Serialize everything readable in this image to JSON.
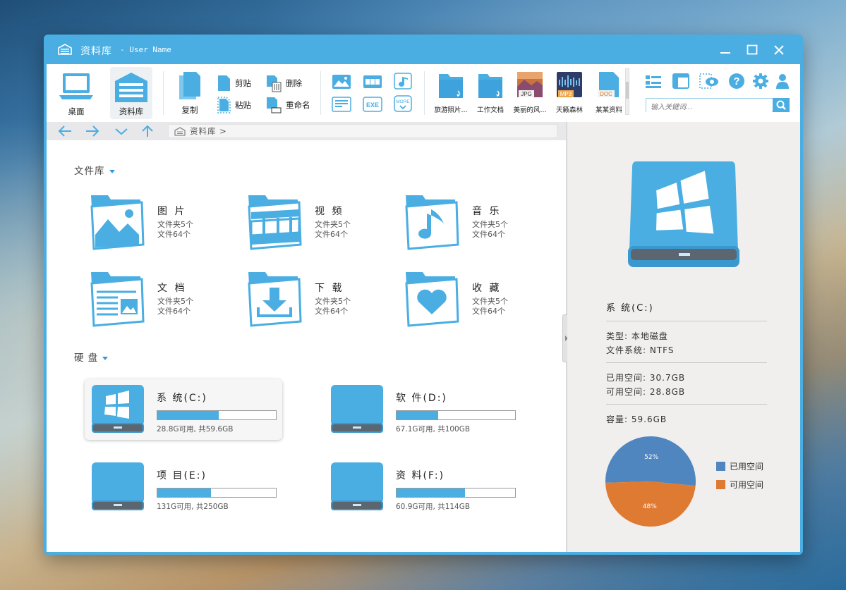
{
  "window": {
    "title": "资料库",
    "subtitle": "- User Name",
    "accent": "#4aaee2"
  },
  "toolbar": {
    "desktop_label": "桌面",
    "library_label": "资料库",
    "copy_label": "复制",
    "cut_label": "剪贴",
    "paste_label": "粘贴",
    "delete_label": "删除",
    "rename_label": "重命名",
    "recent": [
      {
        "label": "旅游照片...",
        "icon": "folder-icon"
      },
      {
        "label": "工作文档",
        "icon": "folder-icon"
      },
      {
        "label": "美丽的风...",
        "badge": "JPG",
        "icon": "jpg-file-icon"
      },
      {
        "label": "天籁森林",
        "badge": "MP3",
        "icon": "mp3-file-icon"
      },
      {
        "label": "某某资料",
        "badge": "DOC",
        "icon": "doc-file-icon"
      }
    ],
    "search_placeholder": "输入关键词..."
  },
  "nav": {
    "breadcrumb": "资料库 >"
  },
  "libraries": {
    "title": "文件库",
    "items": [
      {
        "name": "图 片",
        "folders": "文件夹5个",
        "files": "文件64个",
        "icon": "pictures-folder-icon"
      },
      {
        "name": "视 频",
        "folders": "文件夹5个",
        "files": "文件64个",
        "icon": "video-folder-icon"
      },
      {
        "name": "音 乐",
        "folders": "文件夹5个",
        "files": "文件64个",
        "icon": "music-folder-icon"
      },
      {
        "name": "文 档",
        "folders": "文件夹5个",
        "files": "文件64个",
        "icon": "documents-folder-icon"
      },
      {
        "name": "下 载",
        "folders": "文件夹5个",
        "files": "文件64个",
        "icon": "downloads-folder-icon"
      },
      {
        "name": "收 藏",
        "folders": "文件夹5个",
        "files": "文件64个",
        "icon": "favorites-folder-icon"
      }
    ]
  },
  "drives": {
    "title": "硬 盘",
    "items": [
      {
        "name": "系 统(C:)",
        "info": "28.8G可用, 共59.6GB",
        "used_fraction": 0.52
      },
      {
        "name": "软 件(D:)",
        "info": "67.1G可用, 共100GB",
        "used_fraction": 0.35
      },
      {
        "name": "项 目(E:)",
        "info": "131G可用, 共250GB",
        "used_fraction": 0.45
      },
      {
        "name": "资 料(F:)",
        "info": "60.9G可用, 共114GB",
        "used_fraction": 0.58
      }
    ]
  },
  "details": {
    "title": "系 统(C:)",
    "type": "类型: 本地磁盘",
    "fs": "文件系统: NTFS",
    "used": "已用空间: 30.7GB",
    "free": "可用空间: 28.8GB",
    "capacity": "容量: 59.6GB",
    "legend_used": "已用空间",
    "legend_free": "可用空间",
    "used_color": "#4f86bf",
    "free_color": "#df7a33"
  },
  "chart_data": {
    "type": "pie",
    "categories": [
      "已用空间",
      "可用空间"
    ],
    "values": [
      52,
      48
    ],
    "labels": [
      "52%",
      "48%"
    ]
  }
}
